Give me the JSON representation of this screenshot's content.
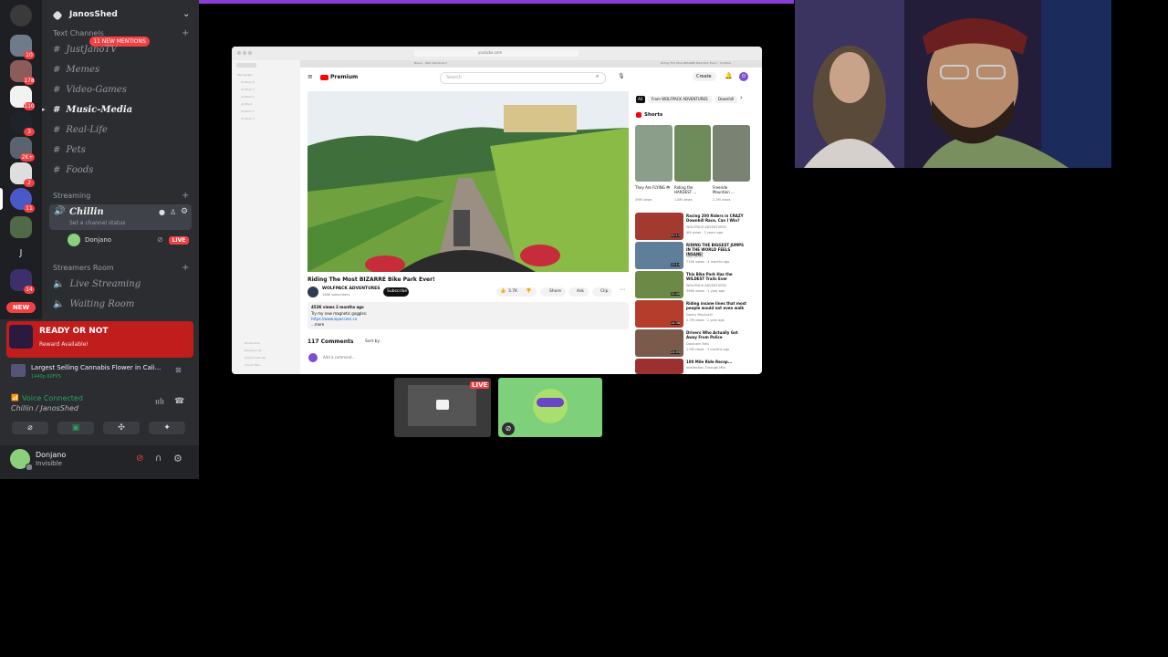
{
  "server": {
    "name": "JanosShed",
    "rail_badges": [
      "10",
      "178",
      "110",
      "3",
      "2K+",
      "2",
      "11",
      "14"
    ],
    "rail_letter": "J",
    "new_label": "NEW"
  },
  "channels": {
    "text_category": "Text Channels",
    "new_mentions": "11 NEW MENTIONS",
    "text": [
      "JustJanoTV",
      "Memes",
      "Video-Games",
      "Music-Media",
      "Real-Life",
      "Pets",
      "Foods"
    ],
    "streaming_category": "Streaming",
    "voice_channel": "Chillin",
    "voice_status": "Set a channel status",
    "voice_user": "Donjano",
    "live": "LIVE",
    "streamers_category": "Streamers Room",
    "streamers": [
      "Live Streaming",
      "Waiting Room"
    ]
  },
  "promo": {
    "game": "READY OR NOT",
    "reward": "Reward Available!"
  },
  "activity": {
    "title": "Largest Selling Cannabis Flower in Cali...",
    "quality": "1440p 60FPS"
  },
  "voice_panel": {
    "status": "Voice Connected",
    "location": "Chillin / JanosShed"
  },
  "user_panel": {
    "name": "Donjano",
    "status": "Invisible"
  },
  "browser": {
    "url": "youtube.com",
    "tab_left": "Brave - Web Dashboard",
    "tab_right": "Riding The Most BIZARRE Bike Park Ever! - YouTube",
    "sidebar_items": [
      "My Groups",
      "Untitled 8",
      "Untitled 3",
      "Untitled 1",
      "Untitled",
      "Untitled 4",
      "Untitled 3"
    ],
    "sidebar_bottom": [
      "Bookmarks",
      "Reading List",
      "Shared with Me",
      "iCloud Tabs"
    ],
    "yt_logo": "Premium",
    "search_placeholder": "Search",
    "create_label": "Create",
    "avatar_letter": "D",
    "video_title": "Riding The Most BIZARRE Bike Park Ever!",
    "channel_name": "WOLFPACK ADVENTURES",
    "subscribers": "148K subscribers",
    "subscribe_label": "Subscribe",
    "likes": "3.7K",
    "share_label": "Share",
    "ask_label": "Ask",
    "clip_label": "Clip",
    "desc_views": "452K views  2 months ago",
    "desc_line": "Try my new magnetic goggles:",
    "desc_link": "https://www.wpaccess.co",
    "desc_more": "...more",
    "comments_count": "117 Comments",
    "sort_by": "Sort by",
    "add_comment": "Add a comment...",
    "chips": [
      "All",
      "From WOLFPACK ADVENTURES",
      "Downhill"
    ],
    "shorts_label": "Shorts",
    "shorts": [
      {
        "title": "They Are FLYING 😳",
        "views": "49M views"
      },
      {
        "title": "Riding the HARDEST ...",
        "views": "1.8M views"
      },
      {
        "title": "Freeride Mountain ...",
        "views": "2.2M views"
      }
    ],
    "recs": [
      {
        "title": "Racing 200 Riders in CRAZY Downhill Race, Can I Win?",
        "channel": "WOLFPACK ADVENTURES",
        "meta": "4M views · 2 years ago",
        "time": "20:11"
      },
      {
        "title": "RIDING THE BIGGEST JUMPS IN THE WORLD FEELS INSANE!",
        "channel": "Matt Jones",
        "meta": "715K views · 4 months ago",
        "time": "13:14"
      },
      {
        "title": "This Bike Park Has the WILDEST Trails Ever",
        "channel": "WOLFPACK ADVENTURES",
        "meta": "396K views · 1 year ago",
        "time": "12:40"
      },
      {
        "title": "Riding insane lines that most people would not even walk",
        "channel": "Danny MacAskill",
        "meta": "2.7M views · 1 year ago",
        "time": "14:38"
      },
      {
        "title": "Drivers Who Actually Got Away From Police",
        "channel": "Dashcam Fails",
        "meta": "1.9M views · 3 months ago",
        "time": "24:05"
      },
      {
        "title": "100 Mile Ride Recap...",
        "channel": "Intellection Through Mtb",
        "meta": "",
        "time": ""
      }
    ]
  },
  "stream_tile": {
    "live": "LIVE"
  },
  "colors": {
    "discord_bg": "#2b2d31",
    "accent": "#f23f42",
    "purple": "#8a3dd6",
    "voice_green": "#23a55a"
  }
}
